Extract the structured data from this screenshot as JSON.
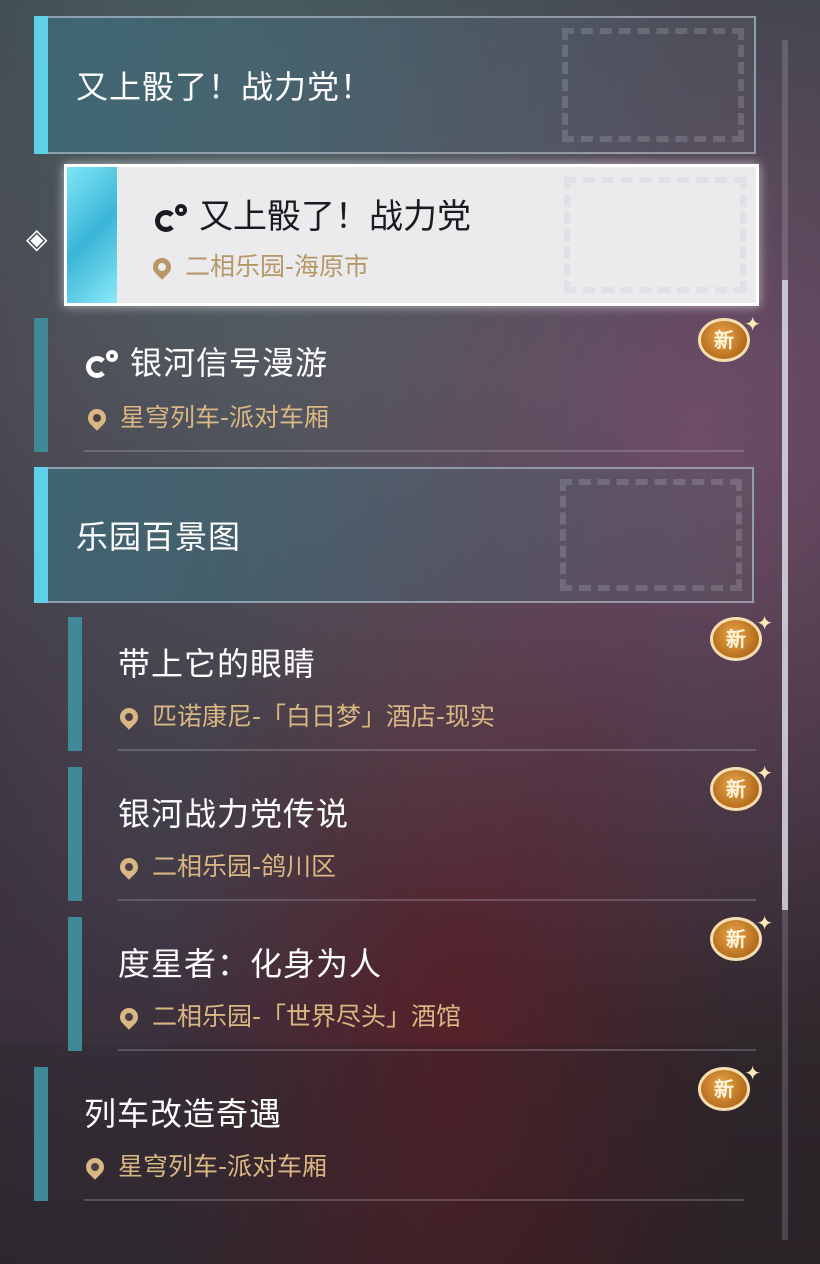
{
  "categories": [
    {
      "title": "又上骰了！战力党！"
    },
    {
      "title": "乐园百景图"
    }
  ],
  "selected_quest": {
    "title": "又上骰了！战力党",
    "location": "二相乐园-海原市",
    "icon": "quest-type-icon"
  },
  "quests": [
    {
      "title": "银河信号漫游",
      "location": "星穹列车-派对车厢",
      "badge": "新",
      "icon": "quest-type-icon"
    },
    {
      "title": "带上它的眼睛",
      "location": "匹诺康尼-「白日梦」酒店-现实",
      "badge": "新"
    },
    {
      "title": "银河战力党传说",
      "location": "二相乐园-鸽川区",
      "badge": "新"
    },
    {
      "title": "度星者：化身为人",
      "location": "二相乐园-「世界尽头」酒馆",
      "badge": "新"
    },
    {
      "title": "列车改造奇遇",
      "location": "星穹列车-派对车厢",
      "badge": "新"
    }
  ],
  "colors": {
    "accent": "#5ed0e8",
    "location": "#d9b783",
    "badge": "#c67f2a"
  }
}
